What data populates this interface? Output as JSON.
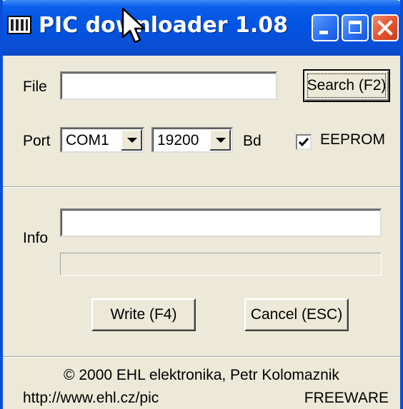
{
  "window": {
    "title": "PIC downloader 1.08",
    "icons": {
      "app": "chip-icon",
      "minimize": "minimize-icon",
      "maximize": "maximize-icon",
      "close": "close-icon",
      "cursor": "arrow-cursor"
    },
    "colors": {
      "titlebar": "#0054e3",
      "close_button": "#e2532c",
      "dialog_background": "#ece9d8"
    }
  },
  "file": {
    "label": "File",
    "value": "",
    "search_button": "Search (F2)"
  },
  "port": {
    "label": "Port",
    "port_value": "COM1",
    "baud_value": "19200",
    "baud_unit": "Bd"
  },
  "eeprom": {
    "label": "EEPROM",
    "checked": true
  },
  "info": {
    "label": "Info",
    "value": "",
    "progress": 0
  },
  "actions": {
    "write_button": "Write (F4)",
    "cancel_button": "Cancel (ESC)"
  },
  "footer": {
    "copyright": "© 2000 EHL elektronika, Petr Kolomaznik",
    "url": "http://www.ehl.cz/pic",
    "license": "FREEWARE"
  }
}
